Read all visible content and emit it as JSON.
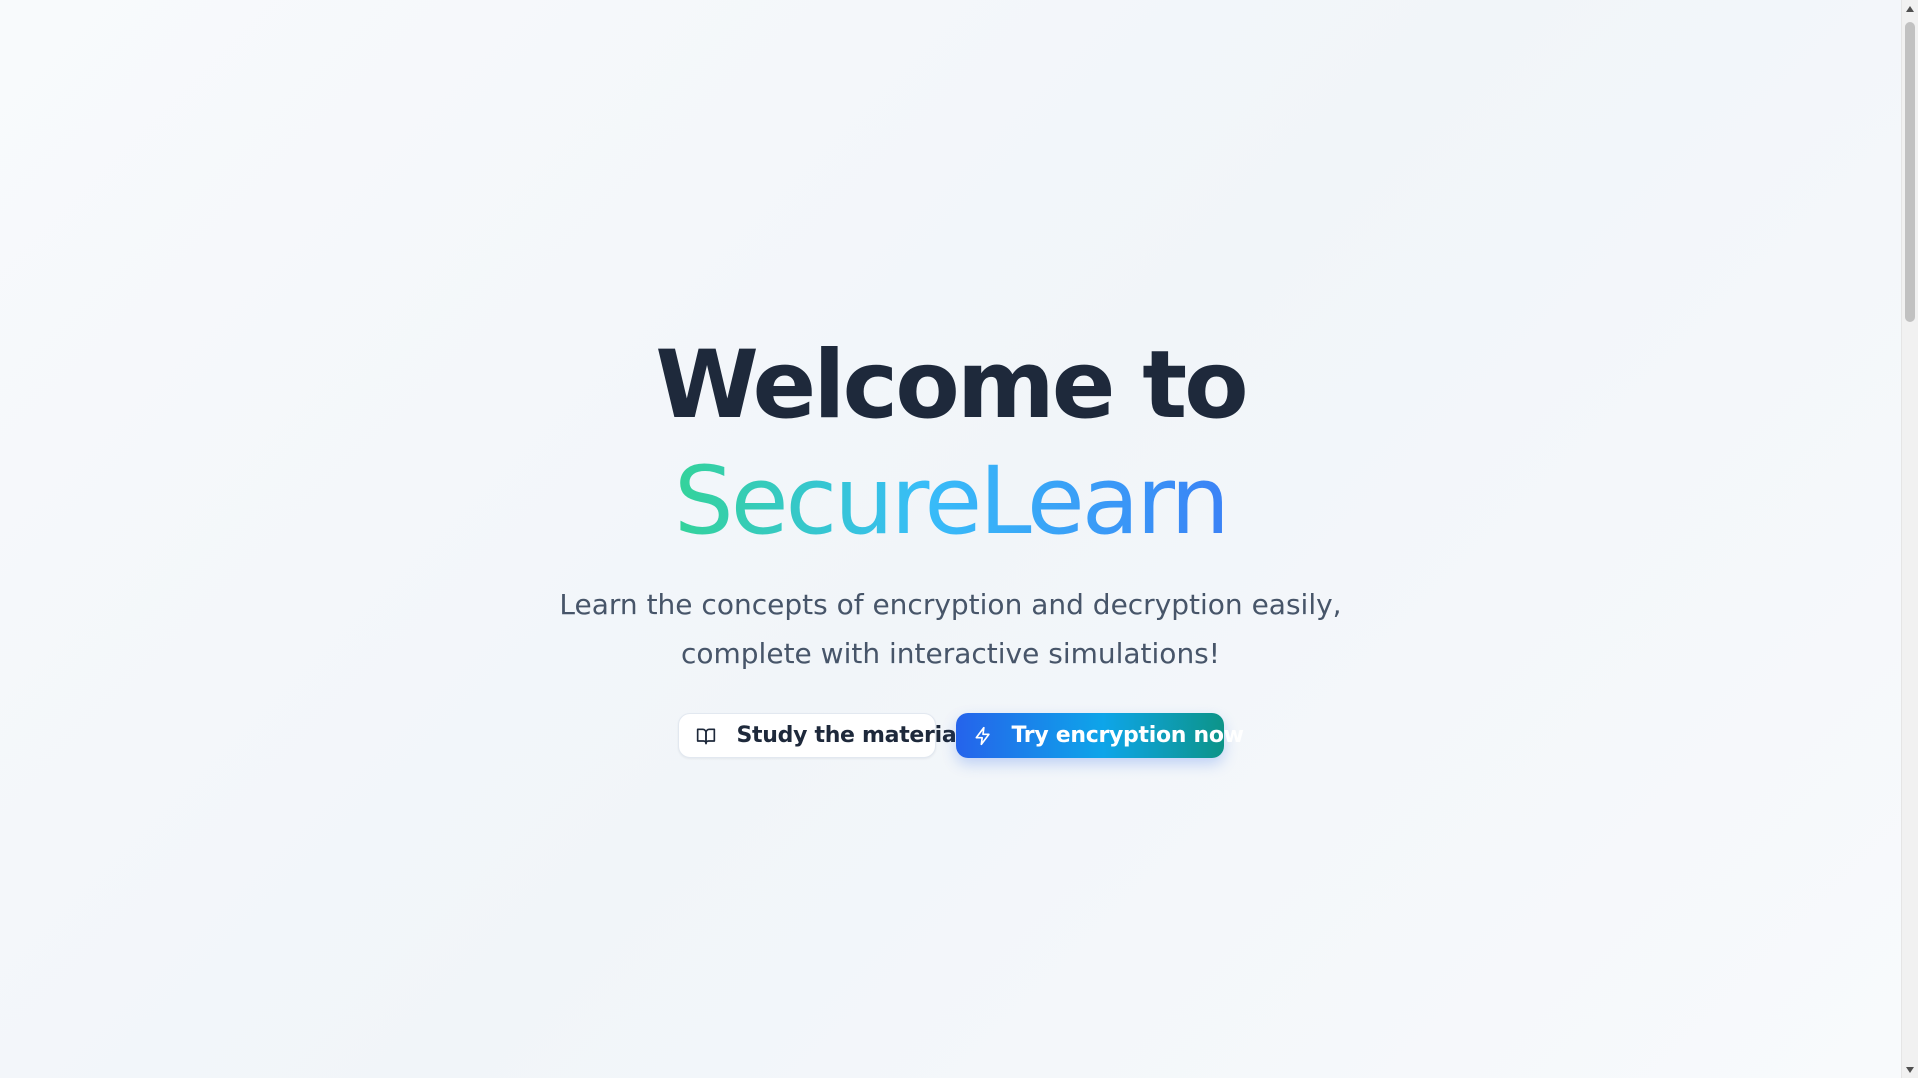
{
  "hero": {
    "title_line1": "Welcome to",
    "brand": "SecureLearn",
    "subtitle_line1": "Learn the concepts of encryption and decryption easily,",
    "subtitle_line2": "complete with interactive simulations!"
  },
  "actions": {
    "study": {
      "label": "Study the material",
      "icon": "book-open-icon"
    },
    "try": {
      "label": "Try encryption now",
      "icon": "lightning-icon"
    }
  },
  "colors": {
    "title": "#1e293b",
    "brand_gradient_start": "#34d399",
    "brand_gradient_end": "#3b82f6",
    "subtitle": "#475569",
    "primary_gradient_start": "#2563eb",
    "primary_gradient_end": "#0d9488",
    "background": "#f8fafc"
  },
  "scrollbar": {
    "up_icon": "scroll-up-arrow-icon",
    "down_icon": "scroll-down-arrow-icon"
  }
}
